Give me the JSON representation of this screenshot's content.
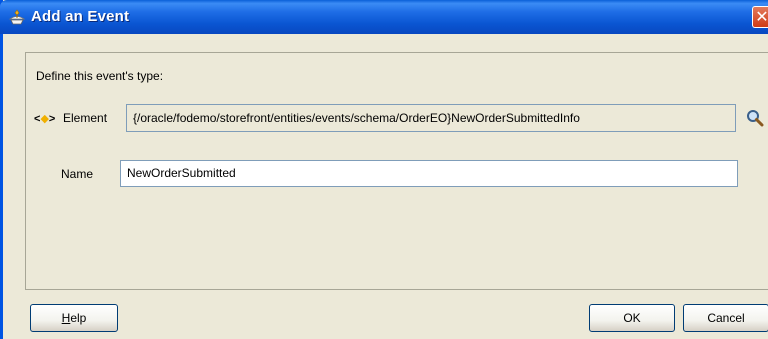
{
  "window": {
    "title": "Add an Event",
    "close_glyph": "✕",
    "icon": "add-event-icon"
  },
  "form": {
    "prompt": "Define this event's type:",
    "element": {
      "icon_text_left": "<",
      "icon_text_mid": "◆",
      "icon_text_right": ">",
      "label": "Element",
      "value": "{/oracle/fodemo/storefront/entities/events/schema/OrderEO}NewOrderSubmittedInfo",
      "search_icon": "magnifier-icon"
    },
    "name": {
      "label": "Name",
      "value": "NewOrderSubmitted"
    }
  },
  "buttons": {
    "help_mnemonic": "H",
    "help_rest": "elp",
    "ok": "OK",
    "cancel": "Cancel"
  }
}
